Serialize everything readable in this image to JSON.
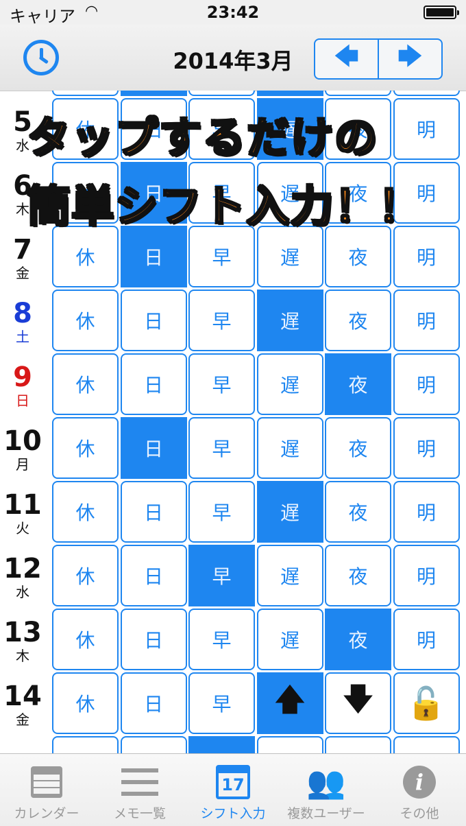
{
  "status_bar": {
    "carrier": "キャリア",
    "time": "23:42"
  },
  "nav": {
    "title": "2014年3月",
    "prev_label": "🡄",
    "next_label": "🡆"
  },
  "shift_labels": [
    "休",
    "日",
    "早",
    "遅",
    "夜",
    "明"
  ],
  "promo": {
    "line1": "タップするだけの",
    "line2": "簡単シフト入力！！"
  },
  "days": [
    {
      "num": "5",
      "weekday": "水",
      "type": "weekday",
      "selected": 3
    },
    {
      "num": "6",
      "weekday": "木",
      "type": "weekday",
      "selected": 1
    },
    {
      "num": "7",
      "weekday": "金",
      "type": "weekday",
      "selected": 1
    },
    {
      "num": "8",
      "weekday": "土",
      "type": "sat",
      "selected": 3
    },
    {
      "num": "9",
      "weekday": "日",
      "type": "sun",
      "selected": 4
    },
    {
      "num": "10",
      "weekday": "月",
      "type": "weekday",
      "selected": 1
    },
    {
      "num": "11",
      "weekday": "火",
      "type": "weekday",
      "selected": 3
    },
    {
      "num": "12",
      "weekday": "水",
      "type": "weekday",
      "selected": 2
    },
    {
      "num": "13",
      "weekday": "木",
      "type": "weekday",
      "selected": 4
    },
    {
      "num": "14",
      "weekday": "金",
      "type": "weekday",
      "selected": 3
    }
  ],
  "row14_tools": {
    "up": "move-up-icon",
    "down": "move-down-icon",
    "lock": "unlock-icon"
  },
  "tabs": [
    {
      "label": "カレンダー",
      "icon": "calendar-icon"
    },
    {
      "label": "メモ一覧",
      "icon": "list-icon"
    },
    {
      "label": "シフト入力",
      "icon": "calendar-17-icon",
      "active": true
    },
    {
      "label": "複数ユーザー",
      "icon": "users-icon"
    },
    {
      "label": "その他",
      "icon": "info-icon"
    }
  ],
  "tab_badge": "17",
  "colors": {
    "accent": "#1e86f0",
    "promo": "#ff8a1a",
    "saturday": "#1a3dd6",
    "sunday": "#d81818"
  }
}
